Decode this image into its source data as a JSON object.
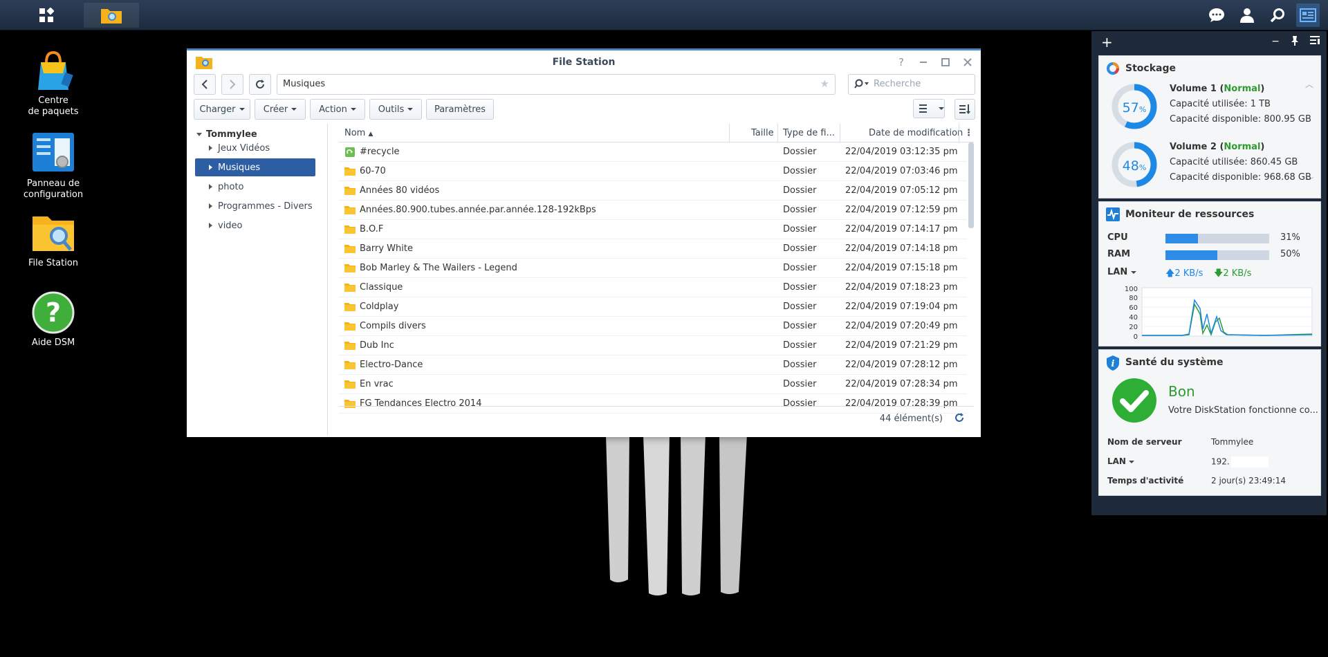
{
  "window": {
    "title": "File Station",
    "path": "Musiques",
    "search_placeholder": "Recherche",
    "toolbar": {
      "upload": "Charger",
      "create": "Créer",
      "action": "Action",
      "tools": "Outils",
      "settings": "Paramètres"
    },
    "tree": {
      "root": "Tommylee",
      "items": [
        {
          "label": "Jeux Vidéos"
        },
        {
          "label": "Musiques"
        },
        {
          "label": "photo"
        },
        {
          "label": "Programmes - Divers"
        },
        {
          "label": "video"
        }
      ]
    },
    "columns": {
      "name": "Nom",
      "size": "Taille",
      "type": "Type de fi...",
      "date": "Date de modification"
    },
    "rows": [
      {
        "name": "#recycle",
        "type": "Dossier",
        "date": "22/04/2019 03:12:35 pm",
        "icon": "recycle-folder-icon"
      },
      {
        "name": "60-70",
        "type": "Dossier",
        "date": "22/04/2019 07:03:46 pm",
        "icon": "folder-icon"
      },
      {
        "name": "Années 80 vidéos",
        "type": "Dossier",
        "date": "22/04/2019 07:05:12 pm",
        "icon": "folder-icon"
      },
      {
        "name": "Années.80.900.tubes.année.par.année.128-192kBps",
        "type": "Dossier",
        "date": "22/04/2019 07:12:59 pm",
        "icon": "folder-icon"
      },
      {
        "name": "B.O.F",
        "type": "Dossier",
        "date": "22/04/2019 07:14:17 pm",
        "icon": "folder-icon"
      },
      {
        "name": "Barry White",
        "type": "Dossier",
        "date": "22/04/2019 07:14:18 pm",
        "icon": "folder-icon"
      },
      {
        "name": "Bob Marley & The Wailers - Legend",
        "type": "Dossier",
        "date": "22/04/2019 07:15:18 pm",
        "icon": "folder-icon"
      },
      {
        "name": "Classique",
        "type": "Dossier",
        "date": "22/04/2019 07:18:23 pm",
        "icon": "folder-icon"
      },
      {
        "name": "Coldplay",
        "type": "Dossier",
        "date": "22/04/2019 07:19:04 pm",
        "icon": "folder-icon"
      },
      {
        "name": "Compils divers",
        "type": "Dossier",
        "date": "22/04/2019 07:20:49 pm",
        "icon": "folder-icon"
      },
      {
        "name": "Dub Inc",
        "type": "Dossier",
        "date": "22/04/2019 07:21:29 pm",
        "icon": "folder-icon"
      },
      {
        "name": "Electro-Dance",
        "type": "Dossier",
        "date": "22/04/2019 07:28:12 pm",
        "icon": "folder-icon"
      },
      {
        "name": "En vrac",
        "type": "Dossier",
        "date": "22/04/2019 07:28:34 pm",
        "icon": "folder-icon"
      },
      {
        "name": "FG Tendances Electro 2014",
        "type": "Dossier",
        "date": "22/04/2019 07:28:39 pm",
        "icon": "folder-icon"
      }
    ],
    "item_count": "44 élément(s)"
  },
  "desktop": {
    "icons": [
      {
        "label": "Centre\nde paquets"
      },
      {
        "label": "Panneau de\nconfiguration"
      },
      {
        "label": "File Station"
      },
      {
        "label": "Aide DSM"
      }
    ]
  },
  "widgets": {
    "storage": {
      "title": "Stockage",
      "volumes": [
        {
          "name": "Volume 1",
          "status": "Normal",
          "percent": 57,
          "pct_text": "57",
          "pct_unit": "%",
          "used": "Capacité utilisée: 1 TB",
          "free": "Capacité disponible: 800.95 GB"
        },
        {
          "name": "Volume 2",
          "status": "Normal",
          "percent": 48,
          "pct_text": "48",
          "pct_unit": "%",
          "used": "Capacité utilisée: 860.45 GB",
          "free": "Capacité disponible: 968.68 GB"
        }
      ]
    },
    "resources": {
      "title": "Moniteur de ressources",
      "cpu_label": "CPU",
      "cpu_value": "31%",
      "cpu_percent": 31,
      "ram_label": "RAM",
      "ram_value": "50%",
      "ram_percent": 50,
      "lan_label": "LAN",
      "up": "2 KB/s",
      "down": "2 KB/s",
      "chart_ticks": [
        "100",
        "80",
        "60",
        "40",
        "20",
        "0"
      ]
    },
    "health": {
      "title": "Santé du système",
      "status": "Bon",
      "message": "Votre DiskStation fonctionne co...",
      "server_label": "Nom de serveur",
      "server_value": "Tommylee",
      "lan_label": "LAN",
      "lan_value": "192.",
      "uptime_label": "Temps d'activité",
      "uptime_value": "2 jour(s) 23:49:14"
    }
  },
  "colors": {
    "accent": "#2d5ea4",
    "ok_green": "#2e9b30",
    "storage_blue": "#1e88e5",
    "folder_yellow": "#f5b21b"
  }
}
